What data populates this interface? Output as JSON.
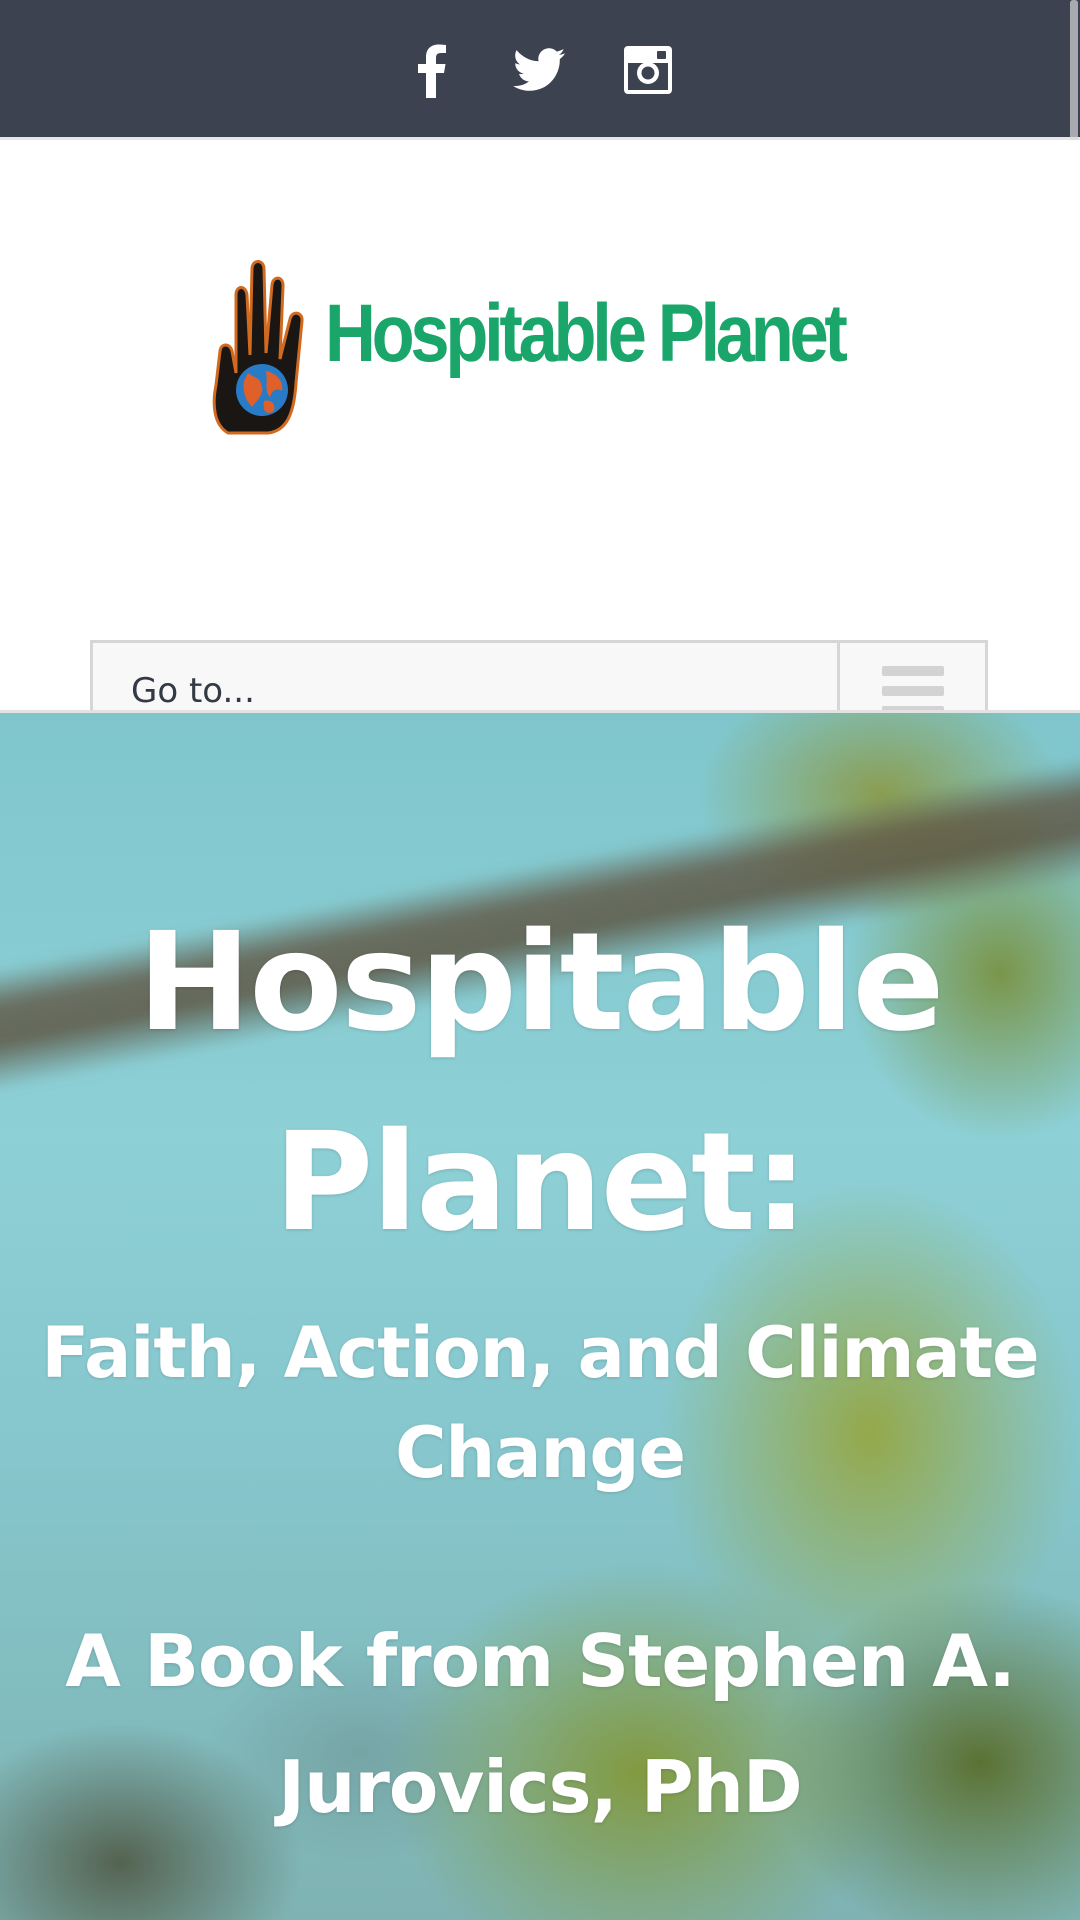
{
  "social": {
    "icons": [
      "facebook-icon",
      "twitter-icon",
      "instagram-icon"
    ]
  },
  "colors": {
    "topbar": "#3c4250",
    "logo_green": "#1aa66a",
    "nav_text": "#333a45",
    "hero_text": "#ffffff"
  },
  "logo": {
    "text": "Hospitable Planet"
  },
  "nav": {
    "select_label": "Go to..."
  },
  "hero": {
    "title_line1": "Hospitable",
    "title_line2": "Planet:",
    "subtitle_line1": "Faith, Action, and Climate",
    "subtitle_line2": "Change",
    "byline": "A Book from Stephen A. Jurovics, PhD"
  }
}
